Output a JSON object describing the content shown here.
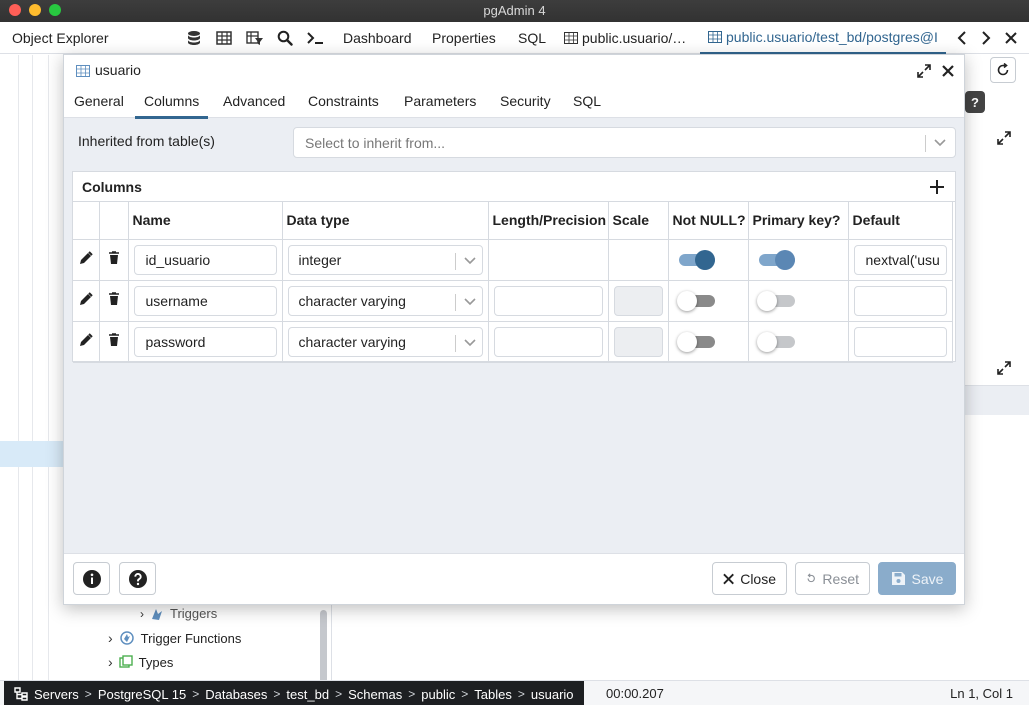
{
  "window": {
    "title": "pgAdmin 4"
  },
  "header": {
    "object_explorer": "Object Explorer",
    "tabs": [
      {
        "label": "Dashboard"
      },
      {
        "label": "Properties"
      },
      {
        "label": "SQL"
      },
      {
        "label": "public.usuario/…"
      },
      {
        "label": "public.usuario/test_bd/postgres@I"
      }
    ]
  },
  "tree": {
    "items": [
      {
        "label": "Triggers"
      },
      {
        "label": "Trigger Functions"
      },
      {
        "label": "Types"
      }
    ]
  },
  "dialog": {
    "title": "usuario",
    "tabs": [
      "General",
      "Columns",
      "Advanced",
      "Constraints",
      "Parameters",
      "Security",
      "SQL"
    ],
    "active_tab": "Columns",
    "inherit_label": "Inherited from table(s)",
    "inherit_placeholder": "Select to inherit from...",
    "columns_title": "Columns",
    "headers": [
      "Name",
      "Data type",
      "Length/Precision",
      "Scale",
      "Not NULL?",
      "Primary key?",
      "Default"
    ],
    "rows": [
      {
        "name": "id_usuario",
        "type": "integer",
        "length": "",
        "scale": "",
        "not_null": true,
        "primary_key": true,
        "default": "nextval('usu"
      },
      {
        "name": "username",
        "type": "character varying",
        "length": "",
        "scale": "",
        "not_null": false,
        "primary_key": false,
        "default": ""
      },
      {
        "name": "password",
        "type": "character varying",
        "length": "",
        "scale": "",
        "not_null": false,
        "primary_key": false,
        "default": ""
      }
    ],
    "footer": {
      "close": "Close",
      "reset": "Reset",
      "save": "Save"
    }
  },
  "statusbar": {
    "breadcrumb": [
      "Servers",
      "PostgreSQL 15",
      "Databases",
      "test_bd",
      "Schemas",
      "public",
      "Tables",
      "usuario"
    ],
    "time": "00:00.207",
    "position": "Ln 1, Col 1"
  }
}
